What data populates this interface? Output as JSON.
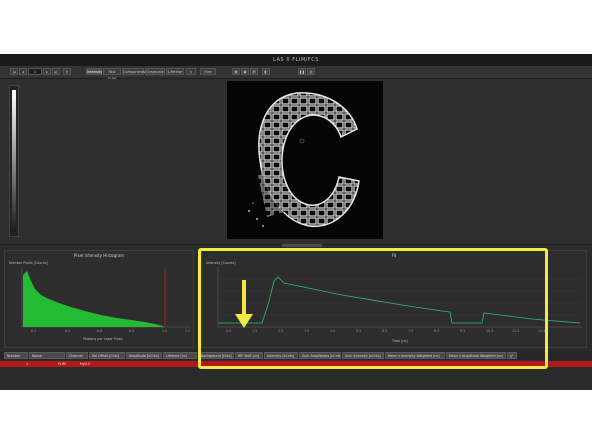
{
  "window": {
    "title": "LAS X FLIM/FCS"
  },
  "toolbar": {
    "frame_value": "1",
    "buttons": [
      "Intensity",
      "Fast FLIM",
      "Components",
      "Grayscale",
      "Lifetime",
      "Free"
    ],
    "active_index": 0
  },
  "histogram": {
    "title": "Pixel Intensity Histogram",
    "ylabel": "Number Pixels [Counts]",
    "xlabel": "Photons per Laser Pulse",
    "bar_color": "#22bb33",
    "marker_color": "#cc2222"
  },
  "fit": {
    "title": "Fit",
    "ylabel": "Intensity [Counts]",
    "xlabel": "Time [ns]",
    "curve_color": "#2bbf6a",
    "highlight_color": "#f4e842"
  },
  "results_table": {
    "columns": [
      "Number",
      "Name",
      "Channel",
      "Sel Offset [Cnts]",
      "Amplitude [kCnts]",
      "Lifetime [ns]",
      "Background [Cnts]",
      "IRF Shift [ns]",
      "Intensity [kCnts]",
      "Sum Amplitudes [kCnts]",
      "Sum Intensity [kCnts]",
      "Mean τ Intensity Weighted [ns]",
      "Mean τ Amplitude Weighted [ns]",
      "χ²"
    ],
    "rows": [
      {
        "number": "1",
        "name": "FLIM",
        "channel": "HyD 2"
      }
    ],
    "row_color": "#b01a1a"
  }
}
